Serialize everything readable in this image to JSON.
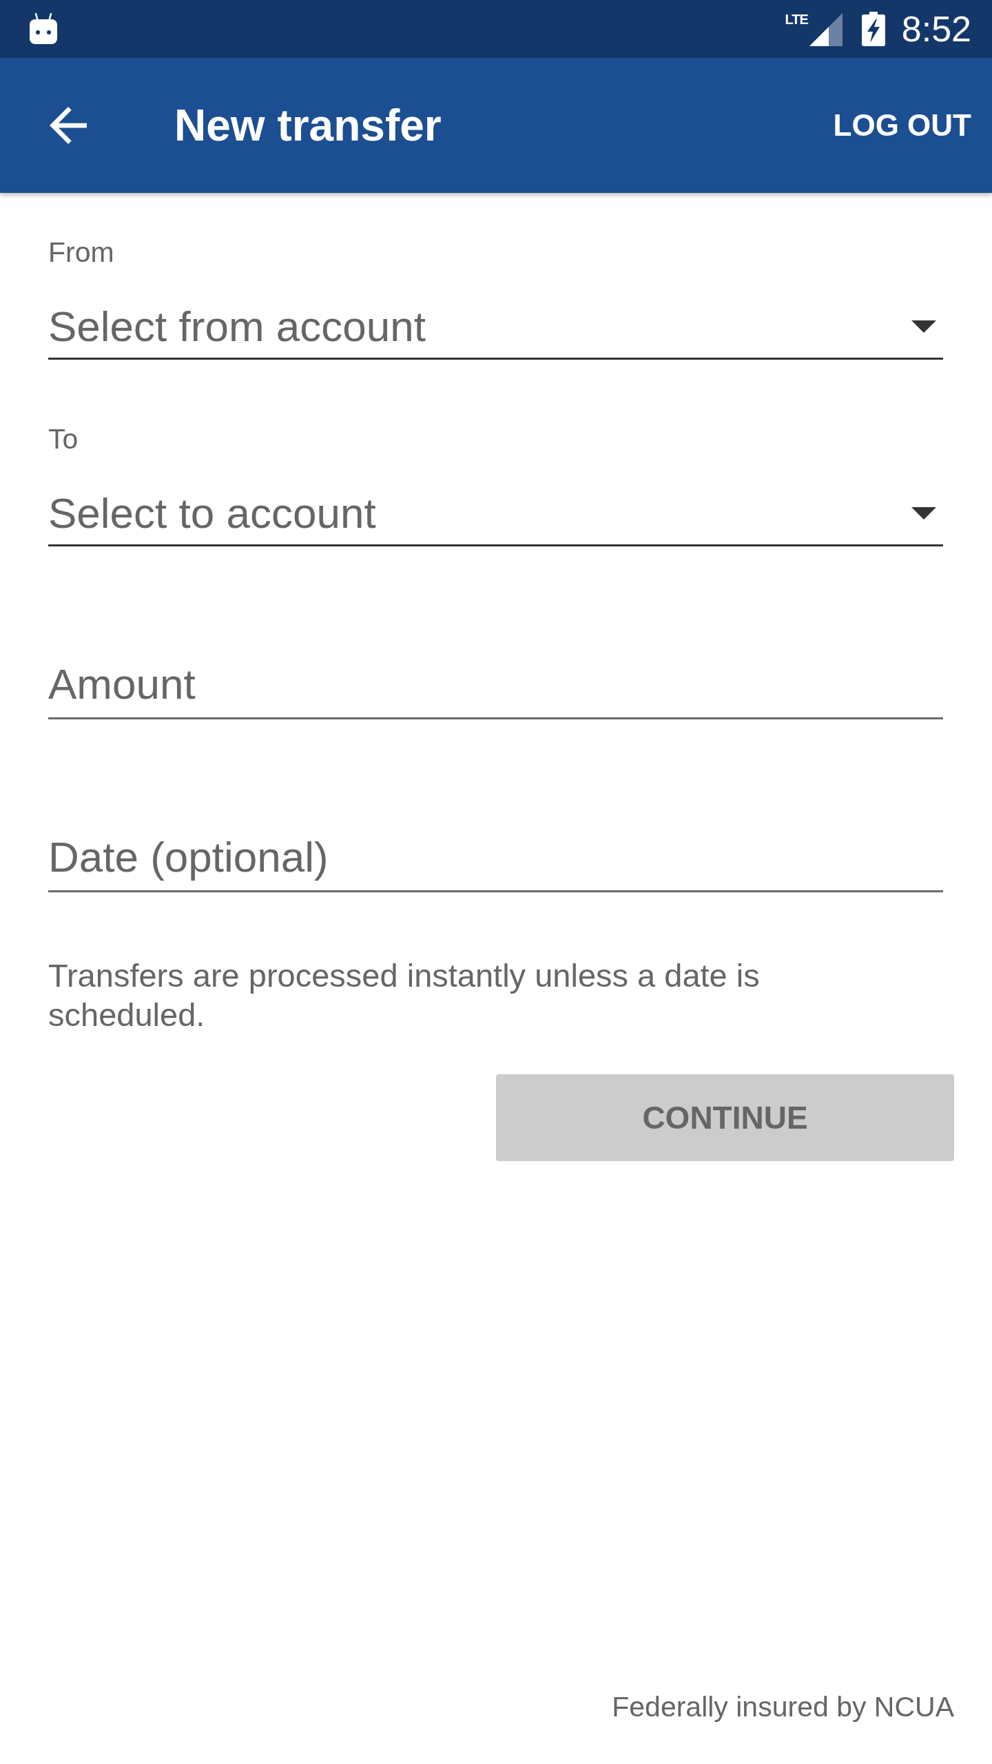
{
  "status_bar": {
    "network": "LTE",
    "time": "8:52"
  },
  "app_bar": {
    "title": "New transfer",
    "action": "LOG OUT"
  },
  "form": {
    "fields": [
      {
        "kind": "dropdown",
        "label": "From",
        "placeholder": "Select from account"
      },
      {
        "kind": "dropdown",
        "label": "To",
        "placeholder": "Select to account"
      },
      {
        "kind": "text",
        "placeholder": "Amount"
      },
      {
        "kind": "text",
        "placeholder": "Date (optional)"
      }
    ],
    "note": "Transfers are processed instantly unless a date is scheduled.",
    "button": {
      "label": "CONTINUE",
      "disabled": true
    }
  },
  "footer": "Federally insured by NCUA"
}
